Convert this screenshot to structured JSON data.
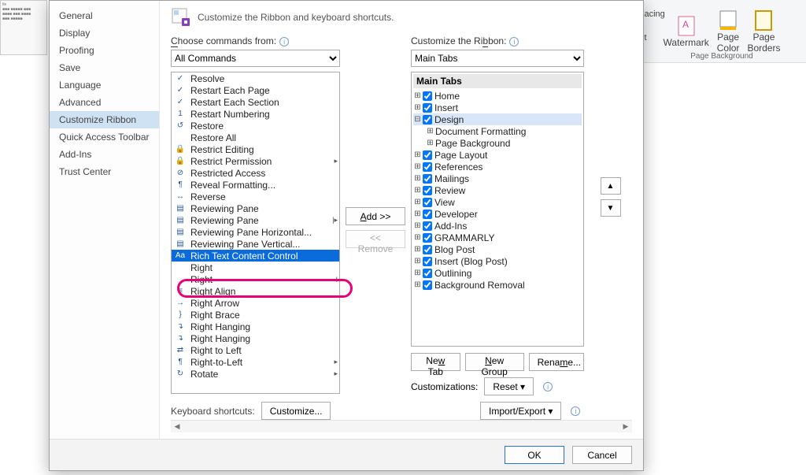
{
  "bg": {
    "spacing_label": "Spacing",
    "watermark": "Watermark",
    "page_color": "Page\nColor",
    "page_borders": "Page\nBorders",
    "group": "Page Background",
    "ult": "ult"
  },
  "categories": [
    "General",
    "Display",
    "Proofing",
    "Save",
    "Language",
    "Advanced",
    "Customize Ribbon",
    "Quick Access Toolbar",
    "Add-Ins",
    "Trust Center"
  ],
  "selected_category_index": 6,
  "header_text": "Customize the Ribbon and keyboard shortcuts.",
  "choose_label": "Choose commands from:",
  "choose_value": "All Commands",
  "customize_label": "Customize the Ribbon:",
  "customize_value": "Main Tabs",
  "commands": [
    {
      "icon": "✓",
      "label": "Resolve"
    },
    {
      "icon": "✓",
      "label": "Restart Each Page"
    },
    {
      "icon": "✓",
      "label": "Restart Each Section"
    },
    {
      "icon": "1",
      "label": "Restart Numbering"
    },
    {
      "icon": "↺",
      "label": "Restore"
    },
    {
      "icon": "",
      "label": "Restore All"
    },
    {
      "icon": "🔒",
      "label": "Restrict Editing"
    },
    {
      "icon": "🔒",
      "label": "Restrict Permission",
      "sub": "▸"
    },
    {
      "icon": "⊘",
      "label": "Restricted Access"
    },
    {
      "icon": "¶",
      "label": "Reveal Formatting..."
    },
    {
      "icon": "↔",
      "label": "Reverse"
    },
    {
      "icon": "▤",
      "label": "Reviewing Pane"
    },
    {
      "icon": "▤",
      "label": "Reviewing Pane",
      "sub": "|▸"
    },
    {
      "icon": "▤",
      "label": "Reviewing Pane Horizontal..."
    },
    {
      "icon": "▤",
      "label": "Reviewing Pane Vertical..."
    },
    {
      "icon": "Aa",
      "label": "Rich Text Content Control",
      "selected": true
    },
    {
      "icon": "",
      "label": "Right"
    },
    {
      "icon": "",
      "label": "Right",
      "sub": "I"
    },
    {
      "icon": "≡",
      "label": "Right Align"
    },
    {
      "icon": "→",
      "label": "Right Arrow"
    },
    {
      "icon": "}",
      "label": "Right Brace"
    },
    {
      "icon": "↴",
      "label": "Right Hanging"
    },
    {
      "icon": "↴",
      "label": "Right Hanging"
    },
    {
      "icon": "⇄",
      "label": "Right to Left"
    },
    {
      "icon": "¶",
      "label": "Right-to-Left",
      "sub": "▸"
    },
    {
      "icon": "↻",
      "label": "Rotate",
      "sub": "▸"
    }
  ],
  "tree_header": "Main Tabs",
  "tree": [
    {
      "pad": 0,
      "tw": "⊞",
      "cb": true,
      "label": "Home"
    },
    {
      "pad": 0,
      "tw": "⊞",
      "cb": true,
      "label": "Insert"
    },
    {
      "pad": 0,
      "tw": "⊟",
      "cb": true,
      "label": "Design",
      "sel": true
    },
    {
      "pad": 1,
      "tw": "⊞",
      "label": "Document Formatting"
    },
    {
      "pad": 1,
      "tw": "⊞",
      "label": "Page Background"
    },
    {
      "pad": 0,
      "tw": "⊞",
      "cb": true,
      "label": "Page Layout"
    },
    {
      "pad": 0,
      "tw": "⊞",
      "cb": true,
      "label": "References"
    },
    {
      "pad": 0,
      "tw": "⊞",
      "cb": true,
      "label": "Mailings"
    },
    {
      "pad": 0,
      "tw": "⊞",
      "cb": true,
      "label": "Review"
    },
    {
      "pad": 0,
      "tw": "⊞",
      "cb": true,
      "label": "View"
    },
    {
      "pad": 0,
      "tw": "⊞",
      "cb": true,
      "label": "Developer"
    },
    {
      "pad": 0,
      "tw": "⊞",
      "cb": true,
      "label": "Add-Ins"
    },
    {
      "pad": 0,
      "tw": "⊞",
      "cb": true,
      "label": "GRAMMARLY"
    },
    {
      "pad": 0,
      "tw": "⊞",
      "cb": true,
      "label": "Blog Post"
    },
    {
      "pad": 0,
      "tw": "⊞",
      "cb": true,
      "label": "Insert (Blog Post)"
    },
    {
      "pad": 0,
      "tw": "⊞",
      "cb": true,
      "label": "Outlining"
    },
    {
      "pad": 0,
      "tw": "⊞",
      "cb": true,
      "label": "Background Removal"
    }
  ],
  "add_label": "Add >>",
  "remove_label": "<< Remove",
  "newtab": "New Tab",
  "newgroup": "New Group",
  "rename": "Rename...",
  "customizations": "Customizations:",
  "reset": "Reset ▾",
  "importexport": "Import/Export ▾",
  "kb_label": "Keyboard shortcuts:",
  "kb_btn": "Customize...",
  "ok": "OK",
  "cancel": "Cancel"
}
